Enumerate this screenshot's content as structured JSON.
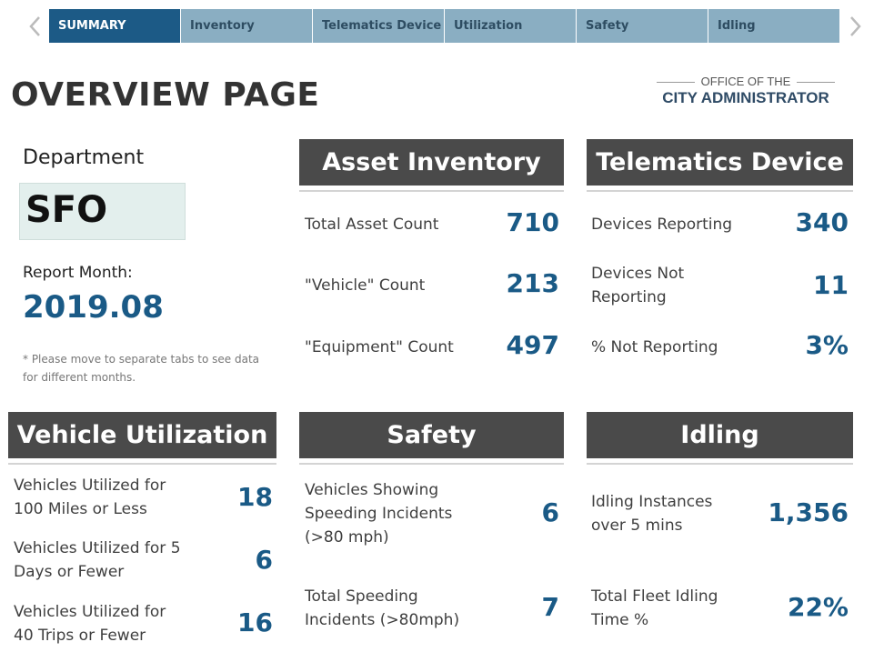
{
  "nav": {
    "tabs": [
      {
        "label": "SUMMARY",
        "active": true
      },
      {
        "label": "Inventory",
        "active": false
      },
      {
        "label": "Telematics Device",
        "active": false
      },
      {
        "label": "Utilization",
        "active": false
      },
      {
        "label": "Safety",
        "active": false
      },
      {
        "label": "Idling",
        "active": false
      }
    ],
    "prev_icon": "chevron-left-icon",
    "next_icon": "chevron-right-icon"
  },
  "page": {
    "title": "OVERVIEW PAGE"
  },
  "logo": {
    "line1": "OFFICE OF THE",
    "line2": "CITY ADMINISTRATOR"
  },
  "filters": {
    "department_label": "Department",
    "department_value": "SFO",
    "month_label": "Report Month:",
    "month_value": "2019.08",
    "note": "* Please move to separate tabs to see data for different months."
  },
  "asset_inventory": {
    "title": "Asset Inventory",
    "rows": [
      {
        "label": "Total Asset Count",
        "value": "710"
      },
      {
        "label": "\"Vehicle\" Count",
        "value": "213"
      },
      {
        "label": "\"Equipment\" Count",
        "value": "497"
      }
    ]
  },
  "telematics": {
    "title": "Telematics Device",
    "rows": [
      {
        "label": "Devices Reporting",
        "value": "340"
      },
      {
        "label": "Devices Not Reporting",
        "value": "11"
      },
      {
        "label": "% Not Reporting",
        "value": "3%"
      }
    ]
  },
  "utilization": {
    "title": "Vehicle Utilization",
    "rows": [
      {
        "label": "Vehicles Utilized for 100 Miles or Less",
        "value": "18"
      },
      {
        "label": "Vehicles Utilized for 5 Days or Fewer",
        "value": "6"
      },
      {
        "label": "Vehicles Utilized for 40 Trips or Fewer",
        "value": "16"
      }
    ]
  },
  "safety": {
    "title": "Safety",
    "rows": [
      {
        "label": "Vehicles Showing Speeding Incidents (>80 mph)",
        "value": "6"
      },
      {
        "label": "Total Speeding Incidents (>80mph)",
        "value": "7"
      }
    ]
  },
  "idling": {
    "title": "Idling",
    "rows": [
      {
        "label": "Idling Instances over 5 mins",
        "value": "1,356"
      },
      {
        "label": "Total Fleet Idling Time %",
        "value": "22%"
      }
    ]
  },
  "colors": {
    "tab_active": "#1c5a86",
    "tab_inactive": "#8aaec2",
    "header_bar": "#4a4a4a",
    "metric_value": "#1a5a86",
    "department_box": "#e3efed"
  }
}
